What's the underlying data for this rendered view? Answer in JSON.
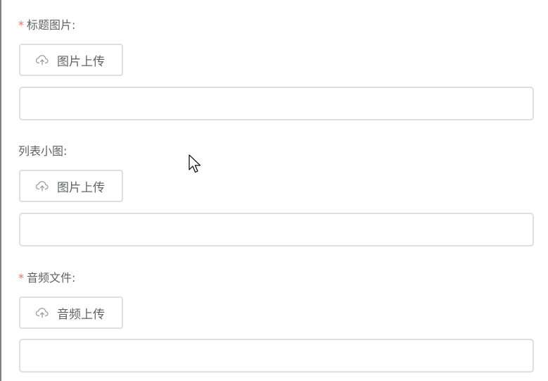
{
  "sections": [
    {
      "label": "标题图片:",
      "required_mark": "*",
      "button_label": "图片上传",
      "input_value": ""
    },
    {
      "label": "列表小图:",
      "required_mark": "",
      "button_label": "图片上传",
      "input_value": ""
    },
    {
      "label": "音频文件:",
      "required_mark": "*",
      "button_label": "音频上传",
      "input_value": ""
    }
  ],
  "icons": {
    "upload": "upload-cloud-icon",
    "cursor": "mouse-pointer-icon"
  },
  "colors": {
    "required": "#f56c6c",
    "text": "#606266",
    "border": "#dcdfe6"
  }
}
